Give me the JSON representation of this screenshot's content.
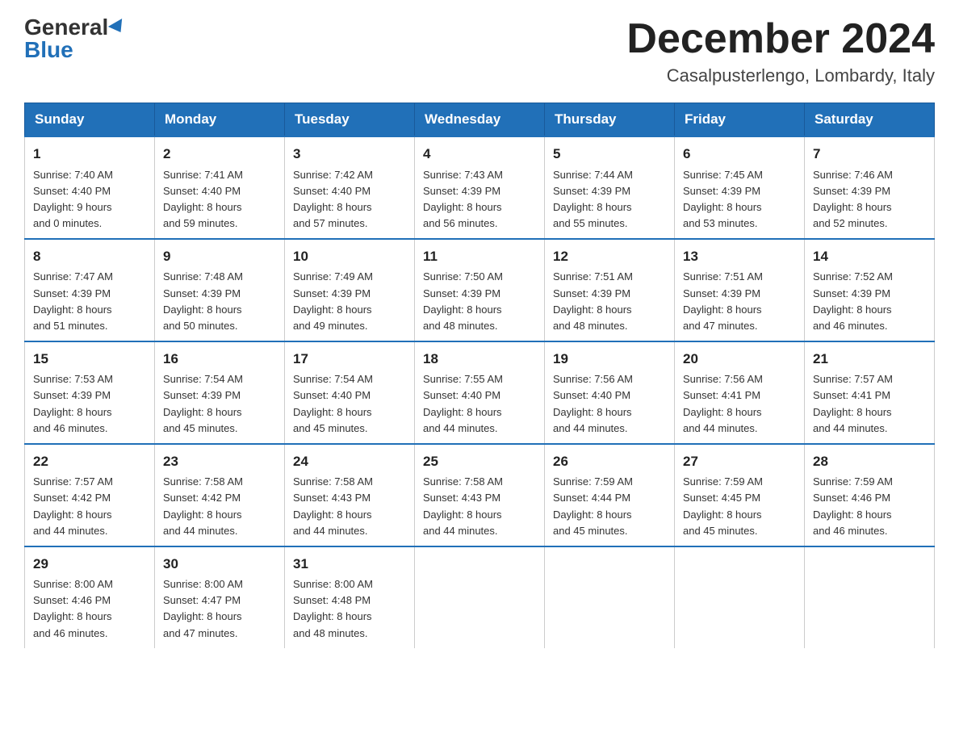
{
  "header": {
    "logo_general": "General",
    "logo_blue": "Blue",
    "month_title": "December 2024",
    "location": "Casalpusterlengo, Lombardy, Italy"
  },
  "days_of_week": [
    "Sunday",
    "Monday",
    "Tuesday",
    "Wednesday",
    "Thursday",
    "Friday",
    "Saturday"
  ],
  "weeks": [
    [
      {
        "day": "1",
        "sunrise": "7:40 AM",
        "sunset": "4:40 PM",
        "daylight": "9 hours and 0 minutes."
      },
      {
        "day": "2",
        "sunrise": "7:41 AM",
        "sunset": "4:40 PM",
        "daylight": "8 hours and 59 minutes."
      },
      {
        "day": "3",
        "sunrise": "7:42 AM",
        "sunset": "4:40 PM",
        "daylight": "8 hours and 57 minutes."
      },
      {
        "day": "4",
        "sunrise": "7:43 AM",
        "sunset": "4:39 PM",
        "daylight": "8 hours and 56 minutes."
      },
      {
        "day": "5",
        "sunrise": "7:44 AM",
        "sunset": "4:39 PM",
        "daylight": "8 hours and 55 minutes."
      },
      {
        "day": "6",
        "sunrise": "7:45 AM",
        "sunset": "4:39 PM",
        "daylight": "8 hours and 53 minutes."
      },
      {
        "day": "7",
        "sunrise": "7:46 AM",
        "sunset": "4:39 PM",
        "daylight": "8 hours and 52 minutes."
      }
    ],
    [
      {
        "day": "8",
        "sunrise": "7:47 AM",
        "sunset": "4:39 PM",
        "daylight": "8 hours and 51 minutes."
      },
      {
        "day": "9",
        "sunrise": "7:48 AM",
        "sunset": "4:39 PM",
        "daylight": "8 hours and 50 minutes."
      },
      {
        "day": "10",
        "sunrise": "7:49 AM",
        "sunset": "4:39 PM",
        "daylight": "8 hours and 49 minutes."
      },
      {
        "day": "11",
        "sunrise": "7:50 AM",
        "sunset": "4:39 PM",
        "daylight": "8 hours and 48 minutes."
      },
      {
        "day": "12",
        "sunrise": "7:51 AM",
        "sunset": "4:39 PM",
        "daylight": "8 hours and 48 minutes."
      },
      {
        "day": "13",
        "sunrise": "7:51 AM",
        "sunset": "4:39 PM",
        "daylight": "8 hours and 47 minutes."
      },
      {
        "day": "14",
        "sunrise": "7:52 AM",
        "sunset": "4:39 PM",
        "daylight": "8 hours and 46 minutes."
      }
    ],
    [
      {
        "day": "15",
        "sunrise": "7:53 AM",
        "sunset": "4:39 PM",
        "daylight": "8 hours and 46 minutes."
      },
      {
        "day": "16",
        "sunrise": "7:54 AM",
        "sunset": "4:39 PM",
        "daylight": "8 hours and 45 minutes."
      },
      {
        "day": "17",
        "sunrise": "7:54 AM",
        "sunset": "4:40 PM",
        "daylight": "8 hours and 45 minutes."
      },
      {
        "day": "18",
        "sunrise": "7:55 AM",
        "sunset": "4:40 PM",
        "daylight": "8 hours and 44 minutes."
      },
      {
        "day": "19",
        "sunrise": "7:56 AM",
        "sunset": "4:40 PM",
        "daylight": "8 hours and 44 minutes."
      },
      {
        "day": "20",
        "sunrise": "7:56 AM",
        "sunset": "4:41 PM",
        "daylight": "8 hours and 44 minutes."
      },
      {
        "day": "21",
        "sunrise": "7:57 AM",
        "sunset": "4:41 PM",
        "daylight": "8 hours and 44 minutes."
      }
    ],
    [
      {
        "day": "22",
        "sunrise": "7:57 AM",
        "sunset": "4:42 PM",
        "daylight": "8 hours and 44 minutes."
      },
      {
        "day": "23",
        "sunrise": "7:58 AM",
        "sunset": "4:42 PM",
        "daylight": "8 hours and 44 minutes."
      },
      {
        "day": "24",
        "sunrise": "7:58 AM",
        "sunset": "4:43 PM",
        "daylight": "8 hours and 44 minutes."
      },
      {
        "day": "25",
        "sunrise": "7:58 AM",
        "sunset": "4:43 PM",
        "daylight": "8 hours and 44 minutes."
      },
      {
        "day": "26",
        "sunrise": "7:59 AM",
        "sunset": "4:44 PM",
        "daylight": "8 hours and 45 minutes."
      },
      {
        "day": "27",
        "sunrise": "7:59 AM",
        "sunset": "4:45 PM",
        "daylight": "8 hours and 45 minutes."
      },
      {
        "day": "28",
        "sunrise": "7:59 AM",
        "sunset": "4:46 PM",
        "daylight": "8 hours and 46 minutes."
      }
    ],
    [
      {
        "day": "29",
        "sunrise": "8:00 AM",
        "sunset": "4:46 PM",
        "daylight": "8 hours and 46 minutes."
      },
      {
        "day": "30",
        "sunrise": "8:00 AM",
        "sunset": "4:47 PM",
        "daylight": "8 hours and 47 minutes."
      },
      {
        "day": "31",
        "sunrise": "8:00 AM",
        "sunset": "4:48 PM",
        "daylight": "8 hours and 48 minutes."
      },
      null,
      null,
      null,
      null
    ]
  ],
  "labels": {
    "sunrise": "Sunrise:",
    "sunset": "Sunset:",
    "daylight": "Daylight:"
  }
}
